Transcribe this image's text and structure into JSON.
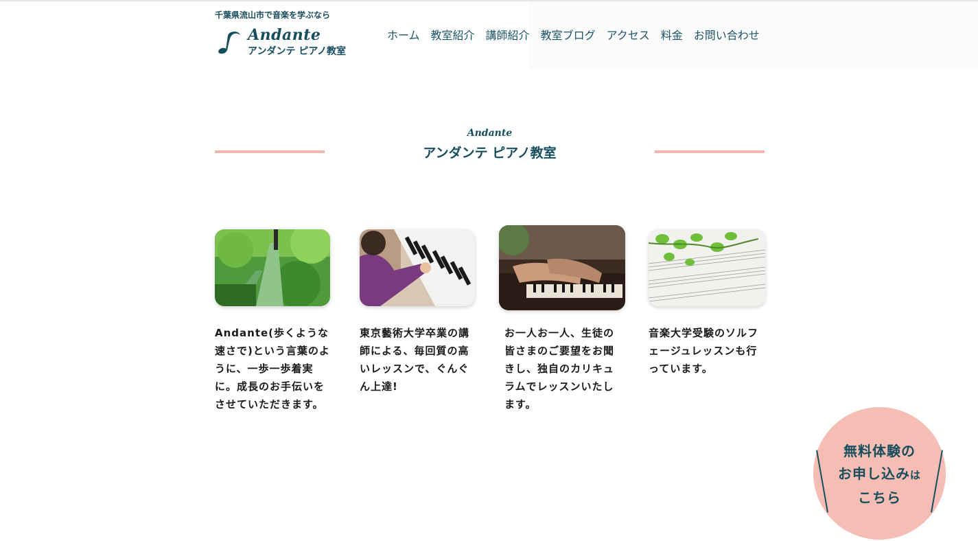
{
  "header": {
    "tagline": "千葉県流山市で音楽を学ぶなら",
    "logo_en": "Andante",
    "logo_jp": "アンダンテ ピアノ教室"
  },
  "nav": {
    "items": [
      {
        "label": "ホーム"
      },
      {
        "label": "教室紹介"
      },
      {
        "label": "講師紹介"
      },
      {
        "label": "教室ブログ"
      },
      {
        "label": "アクセス"
      },
      {
        "label": "料金"
      },
      {
        "label": "お問い合わせ"
      }
    ]
  },
  "section": {
    "heading_en": "Andante",
    "heading_jp": "アンダンテ ピアノ教室"
  },
  "cards": [
    {
      "text": "Andante(歩くような速さで)という言葉のように、一歩一歩着実に。成長のお手伝いをさせていただきます。",
      "image": "forest-boardwalk-photo"
    },
    {
      "text": "東京藝術大学卒業の講師による、毎回質の高いレッスンで、ぐんぐん上達!",
      "image": "child-playing-keyboard-photo"
    },
    {
      "text": "お一人お一人、生徒の皆さまのご要望をお聞きし、独自のカリキュラムでレッスンいたします。",
      "image": "hands-on-piano-photo"
    },
    {
      "text": "音楽大学受験のソルフェージュレッスンも行っています。",
      "image": "sheet-music-leaves-photo"
    }
  ],
  "cta": {
    "line1": "無料体験の",
    "line2a": "お申し込み",
    "line2b": "は",
    "line3": "こちら"
  },
  "colors": {
    "brand": "#174e5e",
    "accent_pink": "#f5bdb3",
    "rule_pink": "#f4b5ad"
  }
}
